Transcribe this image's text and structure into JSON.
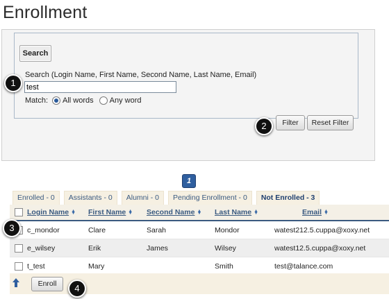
{
  "page": {
    "title": "Enrollment"
  },
  "search": {
    "legend": "Search",
    "label": "Search (Login Name, First Name, Second Name, Last Name, Email)",
    "value": "test",
    "match_label": "Match:",
    "options": [
      "All words",
      "Any word"
    ],
    "selected_option": "All words",
    "filter_label": "Filter",
    "reset_label": "Reset Filter"
  },
  "pagination": {
    "current": "1"
  },
  "tabs": [
    {
      "label": "Enrolled - 0",
      "active": false
    },
    {
      "label": "Assistants - 0",
      "active": false
    },
    {
      "label": "Alumni - 0",
      "active": false
    },
    {
      "label": "Pending Enrollment - 0",
      "active": false
    },
    {
      "label": "Not Enrolled - 3",
      "active": true
    }
  ],
  "table": {
    "columns": [
      "Login Name",
      "First Name",
      "Second Name",
      "Last Name",
      "Email"
    ],
    "rows": [
      {
        "login": "c_mondor",
        "first": "Clare",
        "second": "Sarah",
        "last": "Mondor",
        "email": "watest212.5.cuppa@xoxy.net"
      },
      {
        "login": "e_wilsey",
        "first": "Erik",
        "second": "James",
        "last": "Wilsey",
        "email": "watest12.5.cuppa@xoxy.net"
      },
      {
        "login": "t_test",
        "first": "Mary",
        "second": "",
        "last": "Smith",
        "email": "test@talance.com"
      }
    ]
  },
  "footer": {
    "enroll_label": "Enroll"
  },
  "markers": [
    "1",
    "2",
    "3",
    "4"
  ],
  "colors": {
    "accent": "#2f5f9f",
    "tab_bg": "#f6f0e2",
    "link": "#3a5a80"
  },
  "icons": {
    "sort": "sort-arrows-icon",
    "up": "up-arrow-icon"
  }
}
